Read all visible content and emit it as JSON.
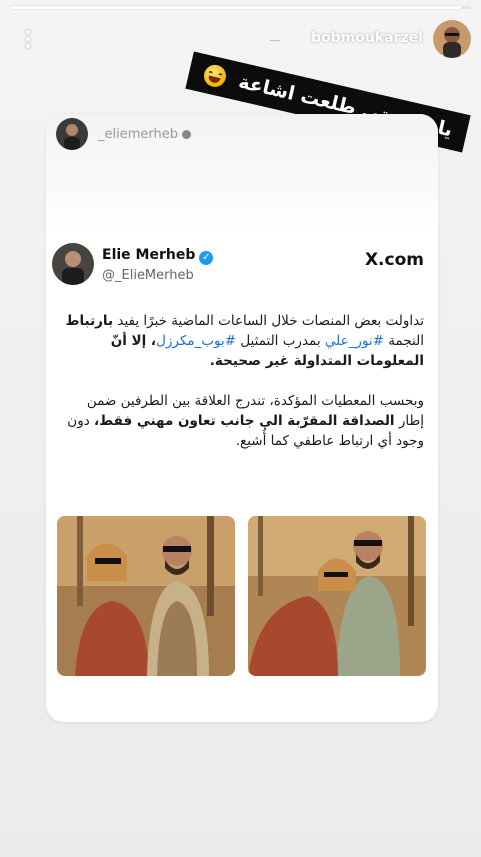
{
  "story": {
    "progress_fraction": 0.98,
    "username": "bobmoukarzel",
    "time": "—"
  },
  "sticker": {
    "text": "يا حسرتي طلعت اشاعة",
    "emoji_icon": "laughing-tears-emoji"
  },
  "card": {
    "repost_handle": "_eliemerheb",
    "tweet": {
      "display_name": "Elie Merheb",
      "handle": "@_ElieMerheb",
      "source": "X.com",
      "para1_a": "تداولت بعض المنصات خلال الساعات الماضية خبرًا يفيد",
      "para1_b": "بارتباط",
      "para1_c": " النجمة ",
      "para1_tag1": "#نور_علي",
      "para1_d": " بمدرب التمثيل ",
      "para1_tag2": "#بوب_مكرزل",
      "para1_e": "، إلا أنّ المعلومات المتداولة غير صحيحة.",
      "para2_a": "وبحسب المعطيات المؤكدة، تندرج العلاقة بين الطرفين ضمن إطار ",
      "para2_b": "الصداقة المقرّبة الى جانب تعاون مهني فقط،",
      "para2_c": " دون وجود أي ارتباط عاطفي كما أُشيع."
    },
    "photos": [
      "couple-photo-1",
      "couple-photo-2"
    ]
  },
  "colors": {
    "accent_link": "#1d6fd6",
    "verified": "#1d9bf0",
    "sticker_bg": "#0c0c0c"
  }
}
